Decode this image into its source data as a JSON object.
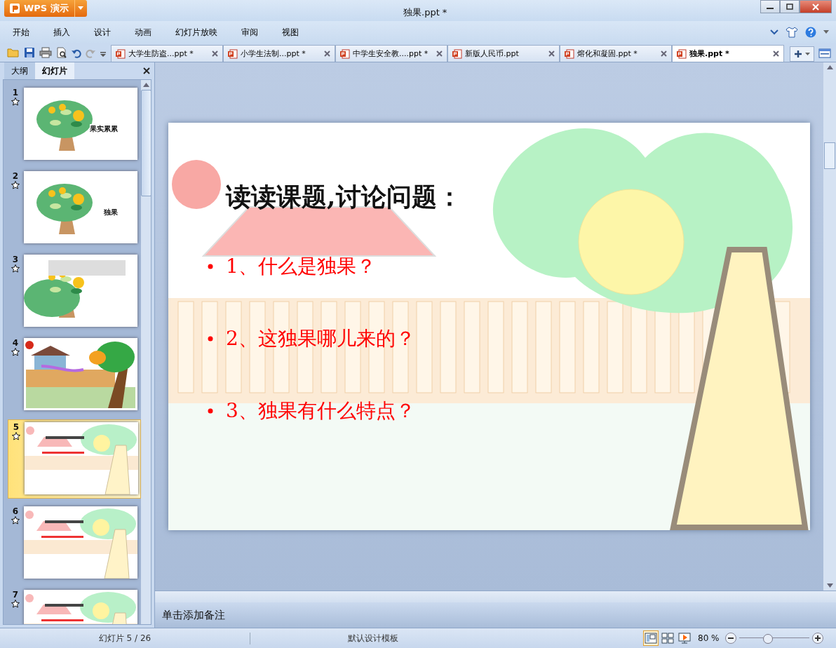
{
  "app_button": {
    "label": "WPS 演示"
  },
  "window": {
    "title": "独果.ppt *"
  },
  "menu": [
    {
      "label": "开始"
    },
    {
      "label": "插入"
    },
    {
      "label": "设计"
    },
    {
      "label": "动画"
    },
    {
      "label": "幻灯片放映"
    },
    {
      "label": "审阅"
    },
    {
      "label": "视图"
    }
  ],
  "doc_tabs": [
    {
      "label": "大学生防盗...ppt *",
      "selected": false
    },
    {
      "label": "小学生法制...ppt *",
      "selected": false
    },
    {
      "label": "中学生安全教....ppt *",
      "selected": false
    },
    {
      "label": "新版人民币.ppt",
      "selected": false
    },
    {
      "label": "熔化和凝固.ppt *",
      "selected": false
    },
    {
      "label": "独果.ppt *",
      "selected": true
    }
  ],
  "panel_tabs": [
    {
      "label": "大纲",
      "selected": false
    },
    {
      "label": "幻灯片",
      "selected": true
    }
  ],
  "slides": [
    {
      "number": "1",
      "kind": "tree",
      "caption": "果实累累",
      "selected": false
    },
    {
      "number": "2",
      "kind": "tree",
      "caption": "独果",
      "selected": false
    },
    {
      "number": "3",
      "kind": "text-tree",
      "selected": false
    },
    {
      "number": "4",
      "kind": "garden",
      "selected": false
    },
    {
      "number": "5",
      "kind": "lesson",
      "selected": true
    },
    {
      "number": "6",
      "kind": "lesson",
      "selected": false
    },
    {
      "number": "7",
      "kind": "lesson",
      "selected": false
    }
  ],
  "slide": {
    "title": "读读课题,讨论问题：",
    "bullets": [
      "1、什么是独果？",
      "2、这独果哪儿来的？",
      "3、独果有什么特点？"
    ]
  },
  "notes": {
    "placeholder": "单击添加备注"
  },
  "status_bar": {
    "slide_count": "幻灯片 5 / 26",
    "template": "默认设计模板",
    "views": [
      {
        "kind": "normal",
        "selected": true
      },
      {
        "kind": "sorter",
        "selected": false
      },
      {
        "kind": "show",
        "selected": false
      }
    ],
    "zoom": "80 %",
    "zoom_slider": {
      "level": 0.4
    }
  }
}
